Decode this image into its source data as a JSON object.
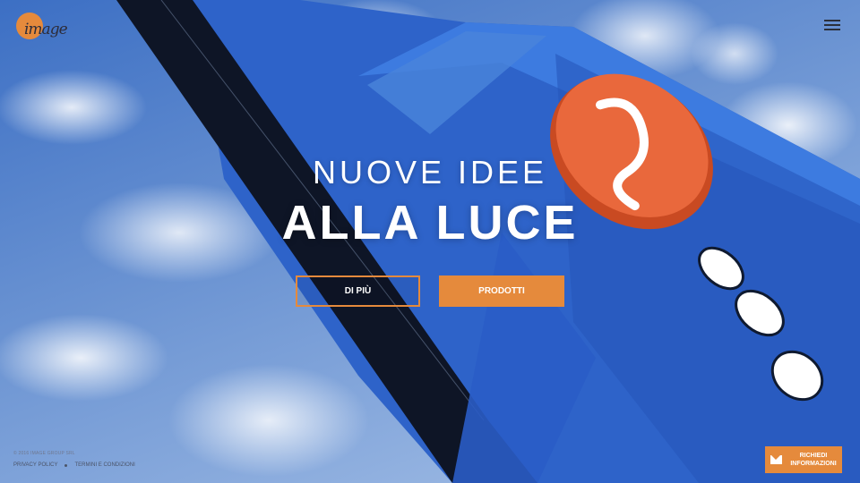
{
  "brand": {
    "logo_text": "image",
    "accent_color": "#e58a3c"
  },
  "header": {
    "menu_icon": "hamburger-icon"
  },
  "hero": {
    "title_line1": "NUOVE IDEE",
    "title_line2": "ALLA LUCE",
    "buttons": {
      "more_label": "DI PIÙ",
      "products_label": "PRODOTTI"
    }
  },
  "footer": {
    "copyright": "© 2016 IMAGE GROUP SRL",
    "links": [
      "PRIVACY POLICY",
      "TERMINI E CONDIZIONI"
    ]
  },
  "contact": {
    "icon": "mail-icon",
    "label_line1": "RICHIEDI",
    "label_line2": "INFORMAZIONI"
  }
}
